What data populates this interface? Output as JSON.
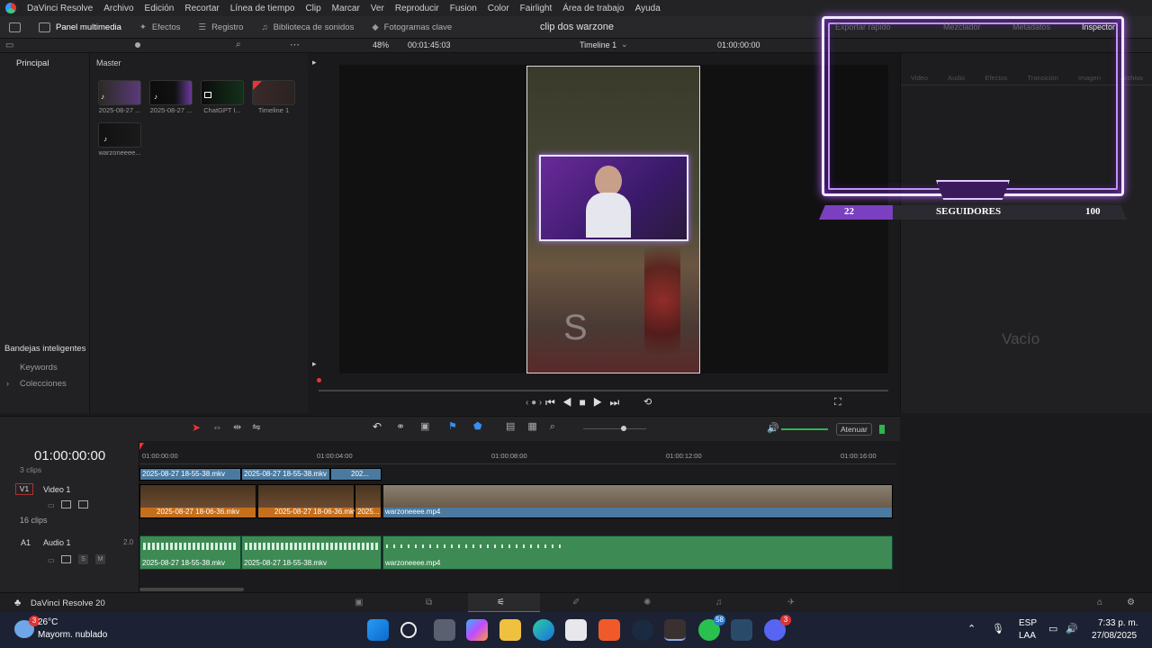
{
  "menubar": {
    "app_name": "DaVinci Resolve",
    "items": [
      "Archivo",
      "Edición",
      "Recortar",
      "Línea de tiempo",
      "Clip",
      "Marcar",
      "Ver",
      "Reproducir",
      "Fusion",
      "Color",
      "Fairlight",
      "Área de trabajo",
      "Ayuda"
    ]
  },
  "toolbar": {
    "panel_multimedia": "Panel multimedia",
    "efectos": "Efectos",
    "registro": "Registro",
    "biblioteca": "Biblioteca de sonidos",
    "fotogramas": "Fotogramas clave",
    "project_title": "clip dos warzone",
    "right": [
      "Exportar rápido",
      "Mezclador",
      "Metadatos",
      "Inspector"
    ]
  },
  "viewer": {
    "zoom": "48%",
    "timecode_left": "00:01:45:03",
    "timeline_name": "Timeline 1",
    "timecode_right": "01:00:00:00"
  },
  "left_panel": {
    "principal": "Principal",
    "smart_bins": "Bandejas inteligentes",
    "keywords": "Keywords",
    "colecciones": "Colecciones"
  },
  "media_pool": {
    "master": "Master",
    "clips": [
      {
        "label": "2025-08-27 ..."
      },
      {
        "label": "2025-08-27 ..."
      },
      {
        "label": "ChatGPT I..."
      },
      {
        "label": "Timeline 1"
      },
      {
        "label": "warzoneeee..."
      }
    ]
  },
  "inspector": {
    "tabs": [
      "Video",
      "Audio",
      "Efectos",
      "Transición",
      "Imagen",
      "Archivo"
    ],
    "empty_label": "Vacío"
  },
  "overlay": {
    "left_count": "22",
    "title": "SEGUIDORES",
    "right_count": "100"
  },
  "timeline_toolbar": {
    "atenuar": "Atenuar"
  },
  "timeline": {
    "timecode": "01:00:00:00",
    "ruler": [
      "01:00:00:00",
      "01:00:04:00",
      "01:00:08:00",
      "01:00:12:00",
      "01:00:16:00"
    ],
    "top_clips_count": "3 clips",
    "top_clips": [
      "2025-08-27 18-55-38.mkv",
      "2025-08-27 18-55-38.mkv",
      "202..."
    ],
    "video_track_id": "V1",
    "video_track_name": "Video 1",
    "video_clips_count": "16 clips",
    "video_clips": [
      "2025-08-27 18-06-36.mkv",
      "2025-08-27 18-06-36.mkv",
      "2025...",
      "warzoneeee.mp4"
    ],
    "audio_track_id": "A1",
    "audio_track_name": "Audio 1",
    "audio_level": "2.0",
    "audio_clips": [
      "2025-08-27 18-55-38.mkv",
      "2025-08-27 18-55-38.mkv",
      "warzoneeee.mp4"
    ],
    "s_label": "S",
    "m_label": "M"
  },
  "pagebar": {
    "brand": "DaVinci Resolve 20"
  },
  "taskbar": {
    "weather_temp": "26°C",
    "weather_desc": "Mayorm. nublado",
    "weather_badge": "3",
    "lang": "ESP",
    "lang2": "LAA",
    "time": "7:33 p. m.",
    "date": "27/08/2025",
    "whatsapp_badge": "58",
    "discord_badge": "3"
  }
}
